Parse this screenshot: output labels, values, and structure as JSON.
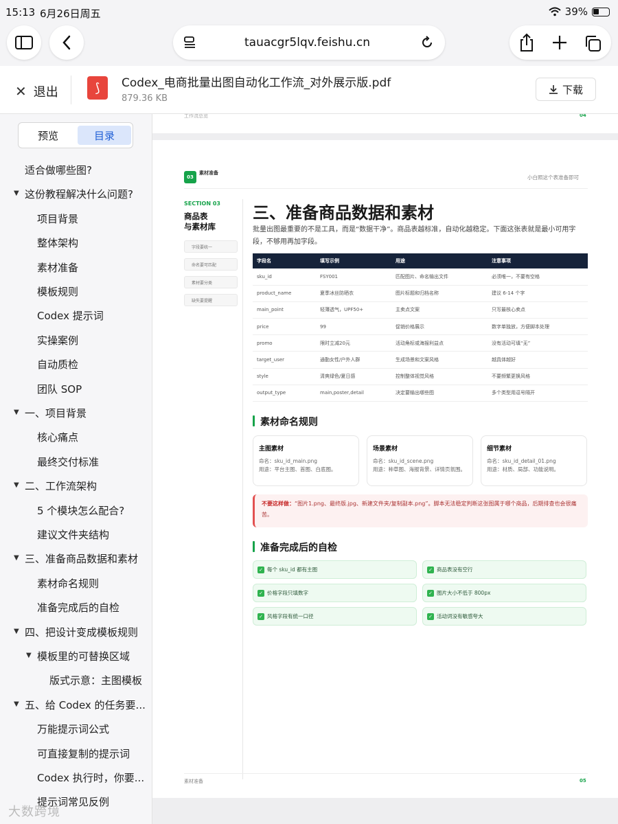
{
  "status": {
    "time": "15:13",
    "date": "6月26日周五",
    "battery": "39%"
  },
  "browser": {
    "url": "tauacgr5lqv.feishu.cn"
  },
  "file": {
    "exit_label": "退出",
    "name": "Codex_电商批量出图自动化工作流_对外展示版.pdf",
    "size": "879.36 KB",
    "download_label": "下载"
  },
  "sidebar": {
    "tabs": [
      "预览",
      "目录"
    ],
    "items": [
      {
        "label": "适合做哪些图?",
        "level": 0,
        "arrow": false
      },
      {
        "label": "这份教程解决什么问题?",
        "level": 0,
        "arrow": true
      },
      {
        "label": "项目背景",
        "level": 1,
        "arrow": false
      },
      {
        "label": "整体架构",
        "level": 1,
        "arrow": false
      },
      {
        "label": "素材准备",
        "level": 1,
        "arrow": false
      },
      {
        "label": "模板规则",
        "level": 1,
        "arrow": false
      },
      {
        "label": "Codex 提示词",
        "level": 1,
        "arrow": false
      },
      {
        "label": "实操案例",
        "level": 1,
        "arrow": false
      },
      {
        "label": "自动质检",
        "level": 1,
        "arrow": false
      },
      {
        "label": "团队 SOP",
        "level": 1,
        "arrow": false
      },
      {
        "label": "一、项目背景",
        "level": 0,
        "arrow": true
      },
      {
        "label": "核心痛点",
        "level": 1,
        "arrow": false
      },
      {
        "label": "最终交付标准",
        "level": 1,
        "arrow": false
      },
      {
        "label": "二、工作流架构",
        "level": 0,
        "arrow": true
      },
      {
        "label": "5 个模块怎么配合?",
        "level": 1,
        "arrow": false
      },
      {
        "label": "建议文件夹结构",
        "level": 1,
        "arrow": false
      },
      {
        "label": "三、准备商品数据和素材",
        "level": 0,
        "arrow": true
      },
      {
        "label": "素材命名规则",
        "level": 1,
        "arrow": false
      },
      {
        "label": "准备完成后的自检",
        "level": 1,
        "arrow": false
      },
      {
        "label": "四、把设计变成模板规则",
        "level": 0,
        "arrow": true
      },
      {
        "label": "模板里的可替换区域",
        "level": 1,
        "arrow": true
      },
      {
        "label": "版式示意：主图模板",
        "level": 2,
        "arrow": false
      },
      {
        "label": "五、给 Codex 的任务要...",
        "level": 0,
        "arrow": true
      },
      {
        "label": "万能提示词公式",
        "level": 1,
        "arrow": false
      },
      {
        "label": "可直接复制的提示词",
        "level": 1,
        "arrow": false
      },
      {
        "label": "Codex 执行时，你要...",
        "level": 1,
        "arrow": false
      },
      {
        "label": "提示词常见反例",
        "level": 1,
        "arrow": false
      }
    ]
  },
  "prev_page": {
    "footer_left": "工作流总览",
    "page_no": "04"
  },
  "page": {
    "badge_num": "03",
    "badge_label": "素材准备",
    "top_right": "小白照这个表准备即可",
    "section_tag": "SECTION 03",
    "side_title": "商品表\n与素材库",
    "side_nav": [
      "字段要统一",
      "命名要可匹配",
      "素材要分类",
      "缺失要提醒"
    ],
    "title": "三、准备商品数据和素材",
    "intro": "批量出图最重要的不是工具，而是“数据干净”。商品表越标准，自动化越稳定。下面这张表就是最小可用字段，不够用再加字段。",
    "table": {
      "headers": [
        "字段名",
        "填写示例",
        "用途",
        "注意事项"
      ],
      "rows": [
        [
          "sku_id",
          "FSY001",
          "匹配图片、命名输出文件",
          "必须唯一，不要有空格"
        ],
        [
          "product_name",
          "夏季冰丝防晒衣",
          "图片标题和归档名称",
          "建议 6-14 个字"
        ],
        [
          "main_point",
          "轻薄透气，UPF50+",
          "主卖点文案",
          "只写最核心卖点"
        ],
        [
          "price",
          "99",
          "促销价格展示",
          "数字单独放，方便脚本处理"
        ],
        [
          "promo",
          "限时立减20元",
          "活动角标或海报利益点",
          "没有活动可填“无”"
        ],
        [
          "target_user",
          "通勤女性/户外人群",
          "生成场景和文案风格",
          "越具体越好"
        ],
        [
          "style",
          "清爽绿色/夏日感",
          "控制整体视觉风格",
          "不要频繁更换风格"
        ],
        [
          "output_type",
          "main,poster,detail",
          "决定要输出哪些图",
          "多个类型用逗号隔开"
        ]
      ]
    },
    "naming_title": "素材命名规则",
    "cards": [
      {
        "title": "主图素材",
        "name": "命名：sku_id_main.png",
        "use": "用途：平台主图、首图、白底图。"
      },
      {
        "title": "场景素材",
        "name": "命名：sku_id_scene.png",
        "use": "用途：种草图、海报背景、详情页氛围。"
      },
      {
        "title": "细节素材",
        "name": "命名：sku_id_detail_01.png",
        "use": "用途：材质、局部、功能说明。"
      }
    ],
    "warning_label": "不要这样做：",
    "warning_text": "“图片1.png、最终版.jpg、新建文件夹/复制副本.png”。脚本无法稳定判断这张图属于哪个商品，后期排查也会很痛苦。",
    "check_title": "准备完成后的自检",
    "checks": [
      "每个 sku_id 都有主图",
      "商品表没有空行",
      "价格字段只填数字",
      "图片大小不低于 800px",
      "风格字段有统一口径",
      "活动词没有敏感夸大"
    ],
    "footer_left": "素材准备",
    "page_no": "05"
  },
  "watermark": "大数跨境",
  "colors": {
    "accent_green": "#16a34a",
    "table_header": "#16233a",
    "active_tab": "#1f5fd6"
  }
}
